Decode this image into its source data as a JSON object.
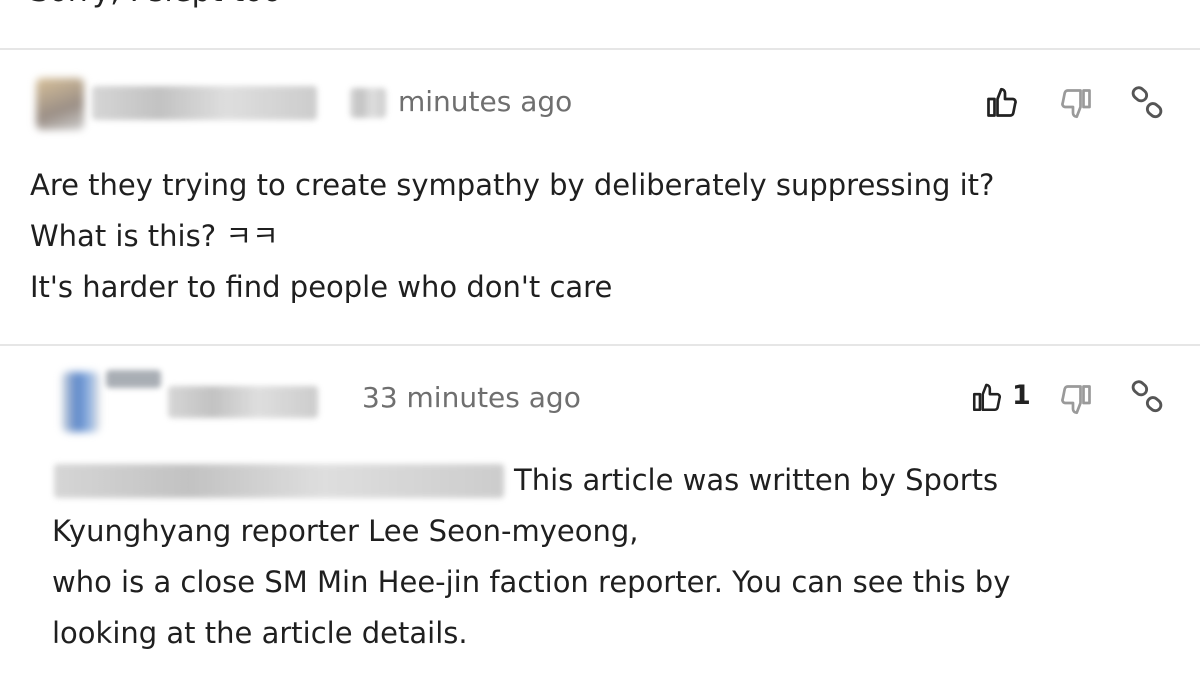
{
  "top_comment": {
    "text_fragment": "Sorry, I slept too"
  },
  "comments": [
    {
      "time_label": "minutes ago",
      "likes": "",
      "lines": [
        "Are they trying to create sympathy by deliberately suppressing it?",
        "What is this? ㅋㅋ",
        "It's harder to find people who don't care"
      ]
    },
    {
      "time_label": "33 minutes ago",
      "likes": "1",
      "lines": [
        "This article was written by Sports",
        "Kyunghyang reporter Lee Seon-myeong,",
        "who is a close SM Min Hee-jin faction reporter. You can see this by",
        "looking at the article details."
      ]
    }
  ],
  "icons": {
    "like": "thumbs-up-icon",
    "dislike": "thumbs-down-icon",
    "share": "link-icon"
  },
  "colors": {
    "text": "#1f1f1f",
    "meta": "#6f6f6f",
    "divider": "#e6e6e6",
    "icon": "#222222",
    "icon_muted": "#9a9a9a"
  }
}
